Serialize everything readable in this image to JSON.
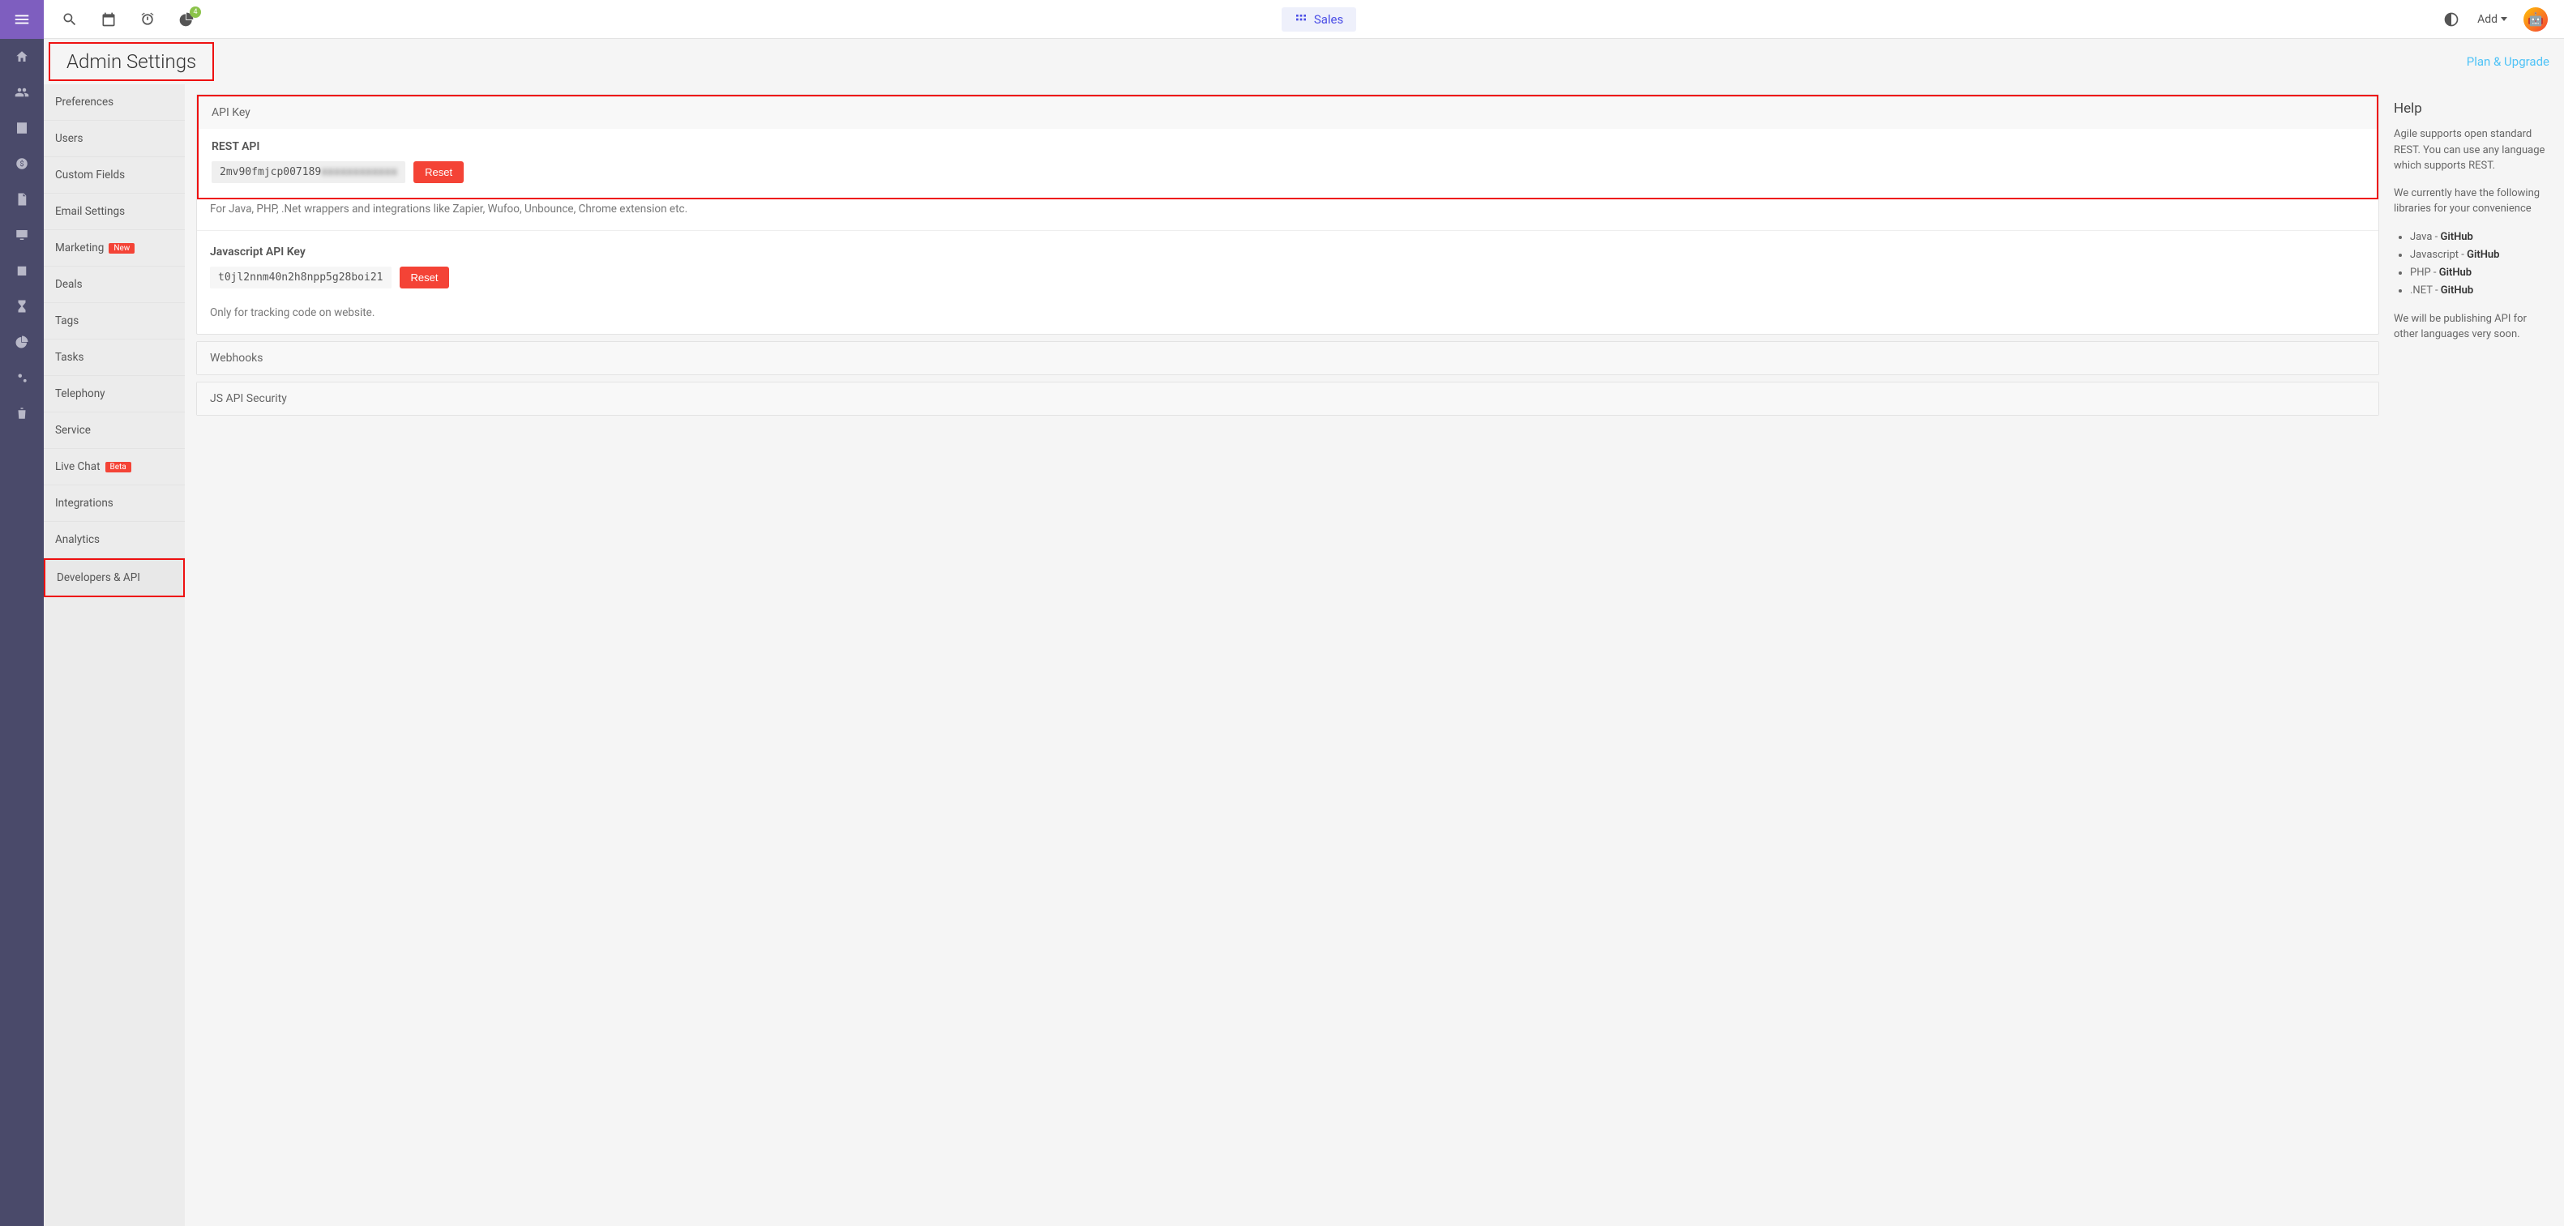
{
  "topbar": {
    "notification_count": "4",
    "sales_label": "Sales",
    "add_label": "Add"
  },
  "header": {
    "title": "Admin Settings",
    "plan_link": "Plan & Upgrade"
  },
  "settings_nav": {
    "items": [
      {
        "label": "Preferences"
      },
      {
        "label": "Users"
      },
      {
        "label": "Custom Fields"
      },
      {
        "label": "Email Settings"
      },
      {
        "label": "Marketing",
        "badge": "New"
      },
      {
        "label": "Deals"
      },
      {
        "label": "Tags"
      },
      {
        "label": "Tasks"
      },
      {
        "label": "Telephony"
      },
      {
        "label": "Service"
      },
      {
        "label": "Live Chat",
        "badge": "Beta"
      },
      {
        "label": "Integrations"
      },
      {
        "label": "Analytics"
      },
      {
        "label": "Developers & API"
      }
    ]
  },
  "api_panel": {
    "title": "API Key",
    "rest_label": "REST API",
    "rest_key_visible": "2mv90fmjcp007189",
    "rest_key_hidden": "xxxxxxxxxxxx",
    "reset_label": "Reset",
    "rest_note": "For Java, PHP, .Net wrappers and integrations like Zapier, Wufoo, Unbounce, Chrome extension etc.",
    "js_label": "Javascript API Key",
    "js_key": "t0jl2nnm40n2h8npp5g28boi21",
    "js_note": "Only for tracking code on website."
  },
  "webhooks_panel": {
    "title": "Webhooks"
  },
  "security_panel": {
    "title": "JS API Security"
  },
  "help": {
    "title": "Help",
    "p1": "Agile supports open standard REST. You can use any language which supports REST.",
    "p2": "We currently have the following libraries for your convenience",
    "libs": [
      {
        "lang": "Java",
        "link": "GitHub"
      },
      {
        "lang": "Javascript",
        "link": "GitHub"
      },
      {
        "lang": "PHP",
        "link": "GitHub"
      },
      {
        "lang": ".NET",
        "link": "GitHub"
      }
    ],
    "p3": "We will be publishing API for other languages very soon."
  }
}
